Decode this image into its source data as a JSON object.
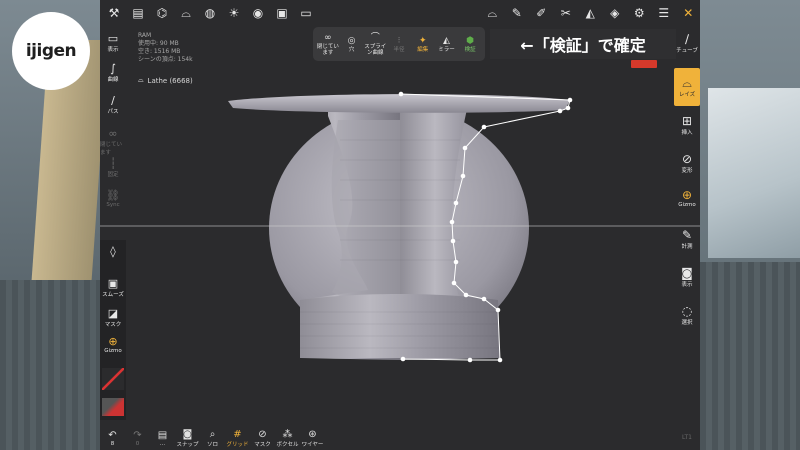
{
  "logo": {
    "text": "ijigen"
  },
  "caption": {
    "text": "←「検証」で確定"
  },
  "hud": {
    "ram": "RAM",
    "used": "使用中: 90 MB",
    "free": "空き: 1516 MB",
    "vertices": "シーンの頂点: 154k"
  },
  "layer": {
    "name": "Lathe (6668)"
  },
  "left_tools": {
    "display": "表示",
    "curve": "曲線",
    "path": "パス",
    "closed": "閉じています",
    "fixed": "固定",
    "sync": "Sync",
    "smooth": "スムーズ",
    "mask": "マスク",
    "gizmo": "Gizmo"
  },
  "popup": {
    "closed": "閉じています",
    "hole": "穴",
    "spline": "スプライン曲線",
    "half": "半径",
    "edit": "編集",
    "mirror": "ミラー",
    "validate": "検証"
  },
  "right_tools": {
    "tube": "チューブ",
    "lathe": "レイズ",
    "insert": "挿入",
    "transform": "変形",
    "gizmo": "Gizmo",
    "measure": "計測",
    "view": "表示",
    "select": "選択"
  },
  "bottom": {
    "undo_count": "8",
    "redo_count": "0",
    "layers_count": "...",
    "snap": "スナップ",
    "solo": "ソロ",
    "grid": "グリッド",
    "mask": "マスク",
    "voxel": "ボクセル",
    "wire": "ワイヤー"
  },
  "version": "LT1",
  "colors": {
    "accent": "#f0b23a",
    "validate": "#5fae4a",
    "background": "#2b2b2d"
  }
}
